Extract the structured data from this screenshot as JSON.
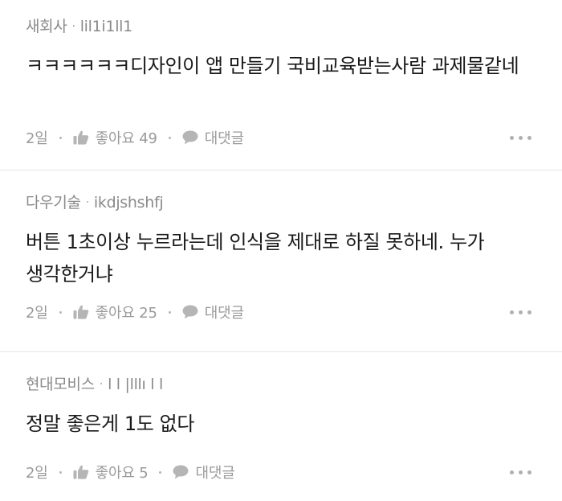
{
  "comments": [
    {
      "category": "새회사",
      "nickname": "lil1i1ll1",
      "text": "ㅋㅋㅋㅋㅋㅋ디자인이 앱 만들기 국비교육받는사람 과제물같네",
      "date": "2일",
      "like_label": "좋아요 49",
      "reply_label": "대댓글"
    },
    {
      "category": "다우기술",
      "nickname": "ikdjshshfj",
      "text": "버튼 1초이상 누르라는데 인식을 제대로 하질 못하네. 누가 생각한거냐",
      "date": "2일",
      "like_label": "좋아요 25",
      "reply_label": "대댓글"
    },
    {
      "category": "현대모비스",
      "nickname": "l l |lllı l l",
      "text": "정말 좋은게 1도 없다",
      "date": "2일",
      "like_label": "좋아요 5",
      "reply_label": "대댓글"
    }
  ],
  "icons": {
    "like": "thumbs-up-icon",
    "reply": "speech-bubble-icon",
    "more": "more-dots-icon"
  },
  "colors": {
    "meta_text": "#8a8a8a",
    "body_text": "#1a1a1a",
    "divider": "#e6e6e6",
    "icon": "#b5b5b5"
  }
}
